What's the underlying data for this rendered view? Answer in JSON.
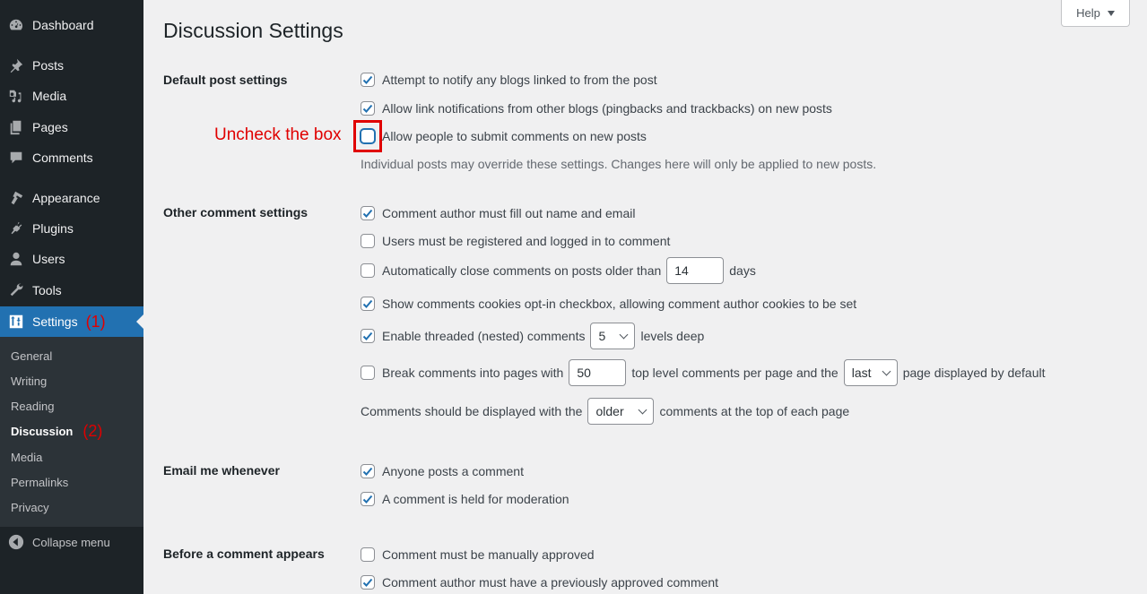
{
  "sidebar": {
    "items": [
      {
        "label": "Dashboard",
        "icon": "dashboard-icon"
      },
      {
        "label": "Posts",
        "icon": "pin-icon"
      },
      {
        "label": "Media",
        "icon": "media-icon"
      },
      {
        "label": "Pages",
        "icon": "pages-icon"
      },
      {
        "label": "Comments",
        "icon": "comment-icon"
      },
      {
        "label": "Appearance",
        "icon": "brush-icon"
      },
      {
        "label": "Plugins",
        "icon": "plug-icon"
      },
      {
        "label": "Users",
        "icon": "user-icon"
      },
      {
        "label": "Tools",
        "icon": "wrench-icon"
      },
      {
        "label": "Settings",
        "icon": "settings-sliders-icon",
        "annotation": "(1)",
        "active": true
      }
    ],
    "submenu": [
      {
        "label": "General"
      },
      {
        "label": "Writing"
      },
      {
        "label": "Reading"
      },
      {
        "label": "Discussion",
        "current": true,
        "annotation": "(2)"
      },
      {
        "label": "Media"
      },
      {
        "label": "Permalinks"
      },
      {
        "label": "Privacy"
      }
    ],
    "collapse_label": "Collapse menu"
  },
  "header": {
    "title": "Discussion Settings",
    "help_label": "Help"
  },
  "annotation": {
    "text": "Uncheck the box",
    "color": "#e00000"
  },
  "sections": {
    "default_post": {
      "label": "Default post settings",
      "options": [
        {
          "label": "Attempt to notify any blogs linked to from the post",
          "checked": true
        },
        {
          "label": "Allow link notifications from other blogs (pingbacks and trackbacks) on new posts",
          "checked": true
        },
        {
          "label": "Allow people to submit comments on new posts",
          "checked": false
        }
      ],
      "description": "Individual posts may override these settings. Changes here will only be applied to new posts."
    },
    "other_comment": {
      "label": "Other comment settings",
      "name_email": {
        "label": "Comment author must fill out name and email",
        "checked": true
      },
      "registered": {
        "label": "Users must be registered and logged in to comment",
        "checked": false
      },
      "auto_close": {
        "label_before": "Automatically close comments on posts older than",
        "value": "14",
        "label_after": "days",
        "checked": false
      },
      "cookies": {
        "label": "Show comments cookies opt-in checkbox, allowing comment author cookies to be set",
        "checked": true
      },
      "threaded": {
        "label_before": "Enable threaded (nested) comments",
        "value": "5",
        "label_after": "levels deep",
        "checked": true
      },
      "paging": {
        "label_before": "Break comments into pages with",
        "per_page": "50",
        "label_middle": "top level comments per page and the",
        "page_default": "last",
        "label_after": "page displayed by default",
        "checked": false
      },
      "order": {
        "label_before": "Comments should be displayed with the",
        "value": "older",
        "label_after": "comments at the top of each page"
      }
    },
    "email": {
      "label": "Email me whenever",
      "options": [
        {
          "label": "Anyone posts a comment",
          "checked": true
        },
        {
          "label": "A comment is held for moderation",
          "checked": true
        }
      ]
    },
    "before_appears": {
      "label": "Before a comment appears",
      "options": [
        {
          "label": "Comment must be manually approved",
          "checked": false
        },
        {
          "label": "Comment author must have a previously approved comment",
          "checked": true
        }
      ]
    }
  },
  "colors": {
    "accent": "#2271b1",
    "sidebar_bg": "#1d2327",
    "submenu_bg": "#2c3338",
    "page_bg": "#f0f0f1"
  }
}
